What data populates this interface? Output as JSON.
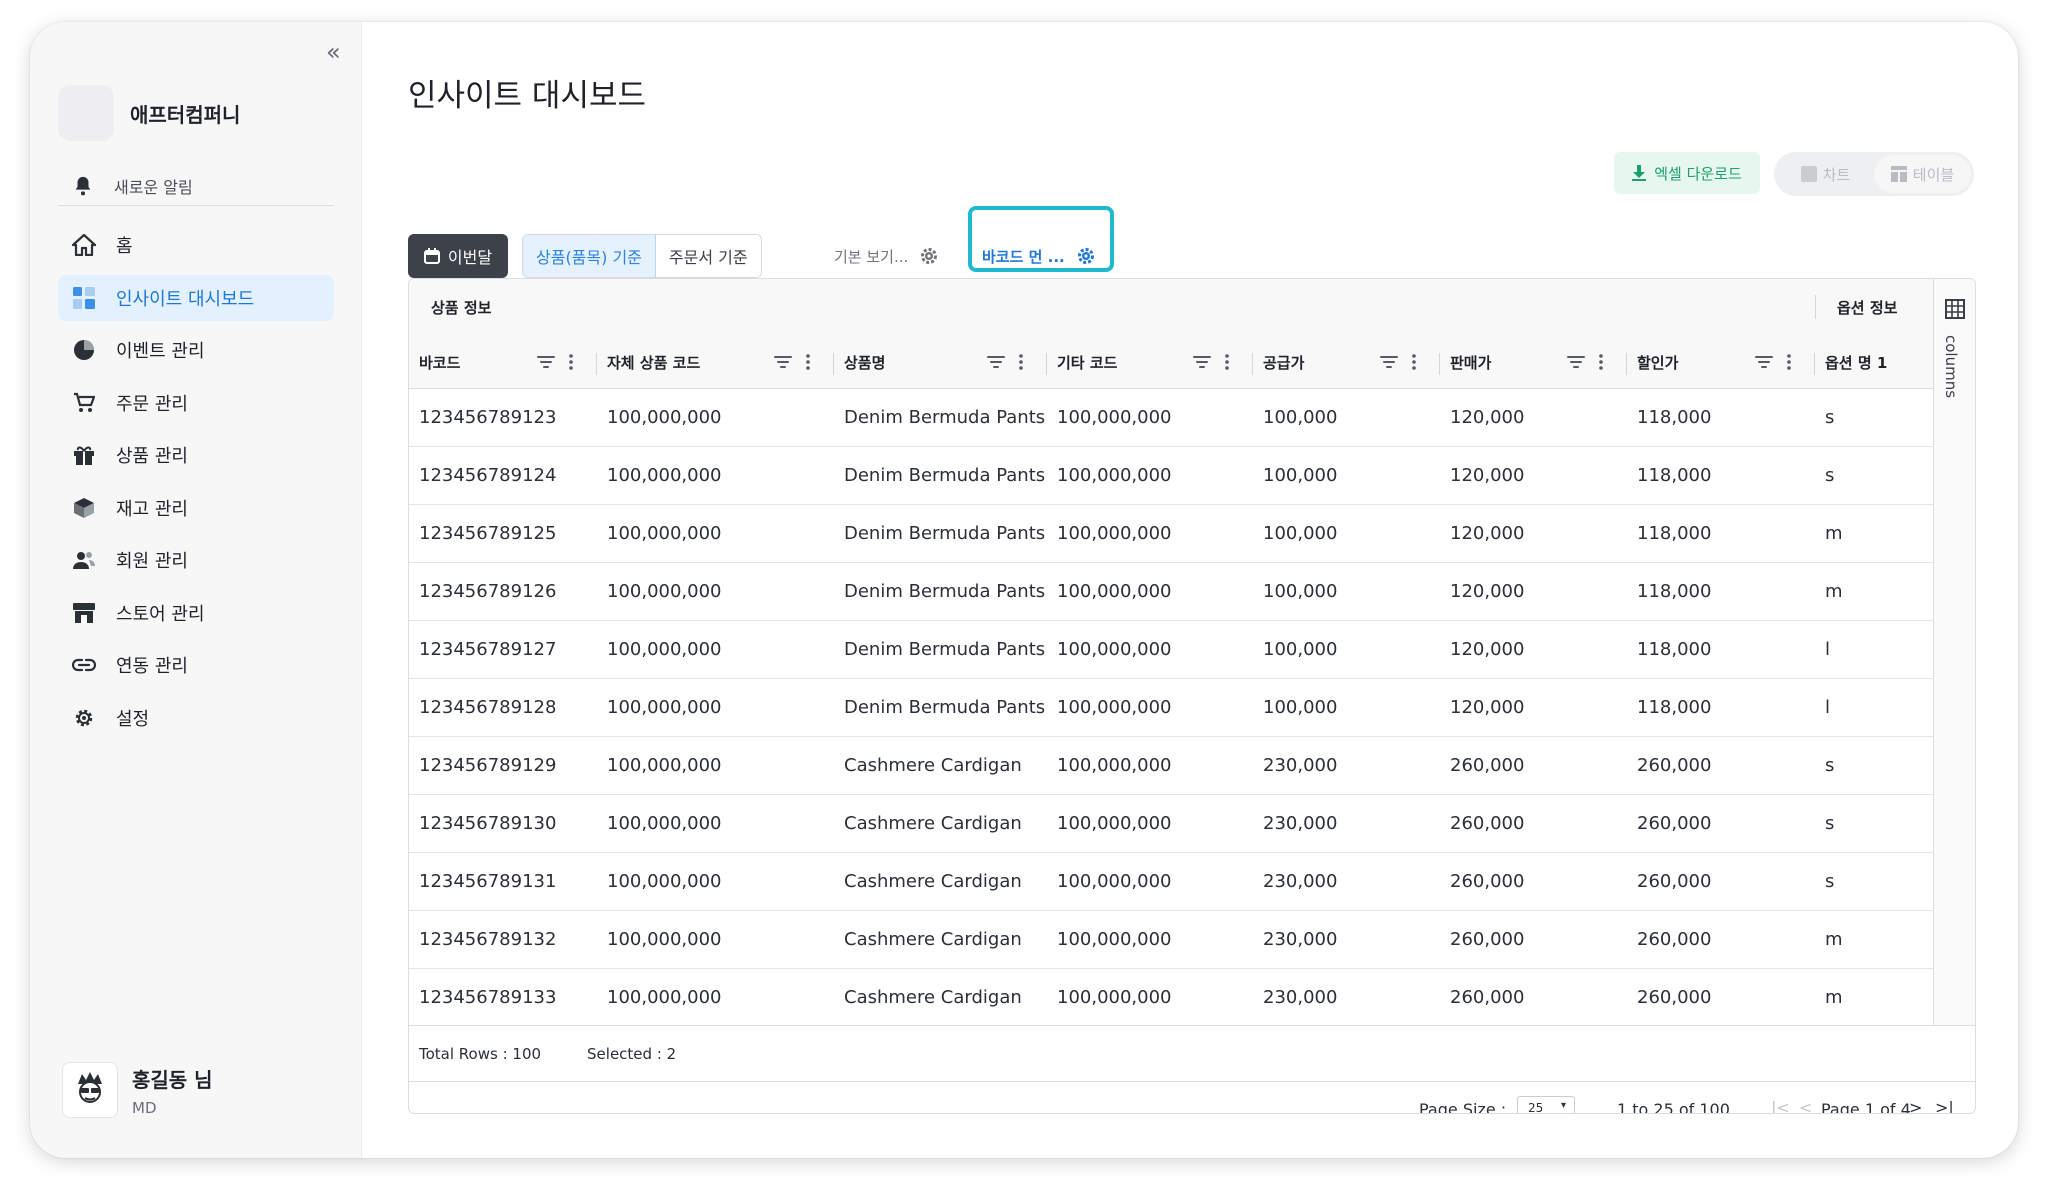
{
  "sidebar": {
    "collapse_glyph": "«",
    "company": "애프터컴퍼니",
    "alert_label": "새로운 알림",
    "items": [
      {
        "label": "홈",
        "icon": "home-icon"
      },
      {
        "label": "인사이트 대시보드",
        "icon": "dashboard-icon",
        "active": true
      },
      {
        "label": "이벤트 관리",
        "icon": "pie-chart-icon"
      },
      {
        "label": "주문 관리",
        "icon": "cart-icon"
      },
      {
        "label": "상품 관리",
        "icon": "gift-icon"
      },
      {
        "label": "재고 관리",
        "icon": "box-icon"
      },
      {
        "label": "회원 관리",
        "icon": "users-icon"
      },
      {
        "label": "스토어 관리",
        "icon": "store-icon"
      },
      {
        "label": "연동 관리",
        "icon": "link-icon"
      },
      {
        "label": "설정",
        "icon": "gear-icon"
      }
    ],
    "user": {
      "name": "홍길동 님",
      "role": "MD"
    }
  },
  "main": {
    "title": "인사이트 대시보드",
    "excel_button": "엑셀 다운로드",
    "view_toggle": {
      "chart": "차트",
      "table": "테이블",
      "selected": "chart"
    },
    "period_button": "이번달",
    "segment": {
      "product": "상품(품목) 기준",
      "order": "주문서 기준",
      "selected": "product"
    },
    "view_tabs": [
      {
        "label": "기본 보기..."
      },
      {
        "label": "바코드 먼 ...",
        "active": true
      }
    ]
  },
  "grid": {
    "group_left": "상품 정보",
    "group_right": "옵션 정보",
    "columns": [
      "바코드",
      "자체 상품 코드",
      "상품명",
      "기타 코드",
      "공급가",
      "판매가",
      "할인가",
      "옵션 명 1"
    ],
    "rows": [
      [
        "123456789123",
        "100,000,000",
        "Denim Bermuda Pants",
        "100,000,000",
        "100,000",
        "120,000",
        "118,000",
        "s"
      ],
      [
        "123456789124",
        "100,000,000",
        "Denim Bermuda Pants",
        "100,000,000",
        "100,000",
        "120,000",
        "118,000",
        "s"
      ],
      [
        "123456789125",
        "100,000,000",
        "Denim Bermuda Pants",
        "100,000,000",
        "100,000",
        "120,000",
        "118,000",
        "m"
      ],
      [
        "123456789126",
        "100,000,000",
        "Denim Bermuda Pants",
        "100,000,000",
        "100,000",
        "120,000",
        "118,000",
        "m"
      ],
      [
        "123456789127",
        "100,000,000",
        "Denim Bermuda Pants",
        "100,000,000",
        "100,000",
        "120,000",
        "118,000",
        "l"
      ],
      [
        "123456789128",
        "100,000,000",
        "Denim Bermuda Pants",
        "100,000,000",
        "100,000",
        "120,000",
        "118,000",
        "l"
      ],
      [
        "123456789129",
        "100,000,000",
        "Cashmere Cardigan",
        "100,000,000",
        "230,000",
        "260,000",
        "260,000",
        "s"
      ],
      [
        "123456789130",
        "100,000,000",
        "Cashmere Cardigan",
        "100,000,000",
        "230,000",
        "260,000",
        "260,000",
        "s"
      ],
      [
        "123456789131",
        "100,000,000",
        "Cashmere Cardigan",
        "100,000,000",
        "230,000",
        "260,000",
        "260,000",
        "s"
      ],
      [
        "123456789132",
        "100,000,000",
        "Cashmere Cardigan",
        "100,000,000",
        "230,000",
        "260,000",
        "260,000",
        "m"
      ],
      [
        "123456789133",
        "100,000,000",
        "Cashmere Cardigan",
        "100,000,000",
        "230,000",
        "260,000",
        "260,000",
        "m"
      ]
    ],
    "side_panel_label": "columns",
    "status": {
      "total": "Total Rows : 100",
      "selected": "Selected : 2"
    },
    "pager": {
      "page_size_label": "Page Size :",
      "page_size": "25",
      "range": "1 to 25 of 100",
      "page_info": "Page 1 of 4"
    }
  }
}
